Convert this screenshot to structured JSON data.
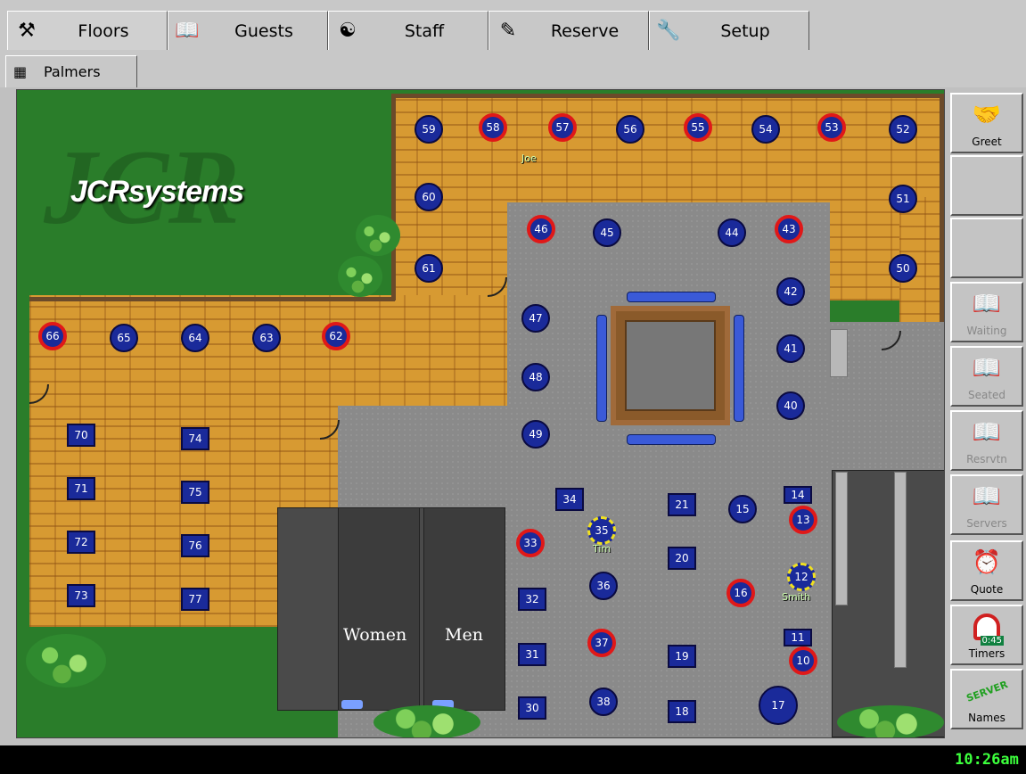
{
  "tabs": [
    {
      "label": "Floors",
      "icon": "anvil-icon"
    },
    {
      "label": "Guests",
      "icon": "book-icon"
    },
    {
      "label": "Staff",
      "icon": "waiter-icon"
    },
    {
      "label": "Reserve",
      "icon": "pen-icon"
    },
    {
      "label": "Setup",
      "icon": "wrench-icon"
    }
  ],
  "subtab": {
    "label": "Palmers",
    "icon": "palette-icon"
  },
  "floor": {
    "logo_text": "JCRsystems",
    "restrooms": {
      "women": "Women",
      "men": "Men"
    },
    "servers": {
      "joe": "Joe",
      "tim": "Tim",
      "smith": "Smith"
    },
    "tables": {
      "t59": "59",
      "t58": "58",
      "t57": "57",
      "t56": "56",
      "t55": "55",
      "t54": "54",
      "t53": "53",
      "t52": "52",
      "t60": "60",
      "t51": "51",
      "t61": "61",
      "t50": "50",
      "t46": "46",
      "t45": "45",
      "t44": "44",
      "t43": "43",
      "t42": "42",
      "t41": "41",
      "t40": "40",
      "t47": "47",
      "t48": "48",
      "t49": "49",
      "t66": "66",
      "t65": "65",
      "t64": "64",
      "t63": "63",
      "t62": "62",
      "t70": "70",
      "t71": "71",
      "t72": "72",
      "t73": "73",
      "t74": "74",
      "t75": "75",
      "t76": "76",
      "t77": "77",
      "t34": "34",
      "t35": "35",
      "t33": "33",
      "t32": "32",
      "t36": "36",
      "t37": "37",
      "t31": "31",
      "t30": "30",
      "t38": "38",
      "t21": "21",
      "t20": "20",
      "t19": "19",
      "t18": "18",
      "t15": "15",
      "t14": "14",
      "t13": "13",
      "t12": "12",
      "t16": "16",
      "t11": "11",
      "t10": "10",
      "t17": "17"
    }
  },
  "side_buttons": [
    {
      "label": "Greet",
      "icon": "handshake-icon",
      "enabled": true
    },
    {
      "label": "",
      "icon": "",
      "enabled": true
    },
    {
      "label": "",
      "icon": "",
      "enabled": true
    },
    {
      "label": "Waiting",
      "icon": "book-icon",
      "enabled": false
    },
    {
      "label": "Seated",
      "icon": "book-icon",
      "enabled": false
    },
    {
      "label": "Resrvtn",
      "icon": "book-icon",
      "enabled": false
    },
    {
      "label": "Servers",
      "icon": "book-icon",
      "enabled": false
    },
    {
      "label": "Quote",
      "icon": "alarm-clock-icon",
      "enabled": true
    },
    {
      "label": "Timers",
      "icon": "timer-icon",
      "timer_text": "0:45",
      "enabled": true
    },
    {
      "label": "Names",
      "icon": "server-names-icon",
      "badge": "SERVER",
      "enabled": true
    }
  ],
  "status": {
    "clock": "10:26am"
  },
  "colors": {
    "occupied": "#e01818",
    "table": "#1a2a9a",
    "pending": "#f0e020",
    "clock": "#3cff3c"
  }
}
